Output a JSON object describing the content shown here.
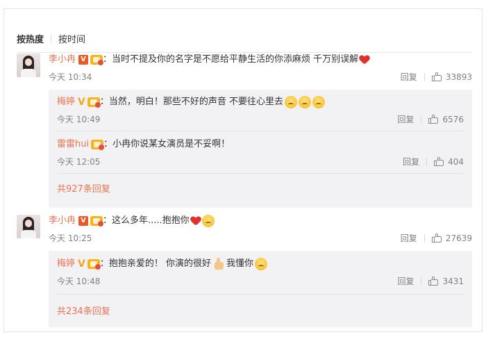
{
  "sort": {
    "hot": "按热度",
    "time": "按时间"
  },
  "comments": [
    {
      "user": "李小冉",
      "text": "：当时不提及你的名字是不愿给平静生活的你添麻烦 千万别误解",
      "time": "今天 10:34",
      "reply_label": "回复",
      "likes": "33893",
      "replies": [
        {
          "user": "梅婷",
          "text": "：当然，明白！那些不好的声音 不要往心里去",
          "time": "今天 10:49",
          "reply_label": "回复",
          "likes": "6576"
        },
        {
          "user": "雷雷hui",
          "text": "：小冉你说某女演员是不妥啊！",
          "time": "今天 12:05",
          "reply_label": "回复",
          "likes": "404"
        }
      ],
      "more": "共927条回复"
    },
    {
      "user": "李小冉",
      "text": "：这么多年.....抱抱你",
      "time": "今天 10:25",
      "reply_label": "回复",
      "likes": "27639",
      "replies": [
        {
          "user": "梅婷",
          "text": "：抱抱亲爱的！ 你演的很好",
          "text2": " 我懂你",
          "time": "今天 10:48",
          "reply_label": "回复",
          "likes": "3431"
        }
      ],
      "more": "共234条回复"
    }
  ],
  "icons": {
    "verified": "verified-badge-icon",
    "vip": "vip-crown-icon",
    "like": "thumbs-up-outline-icon",
    "heart": "red-heart-emoji-icon",
    "emoji": "sad-face-emoji-icon"
  },
  "colors": {
    "username": "#eb7350",
    "meta": "#808080",
    "reply_bg": "#f2f2f5"
  }
}
